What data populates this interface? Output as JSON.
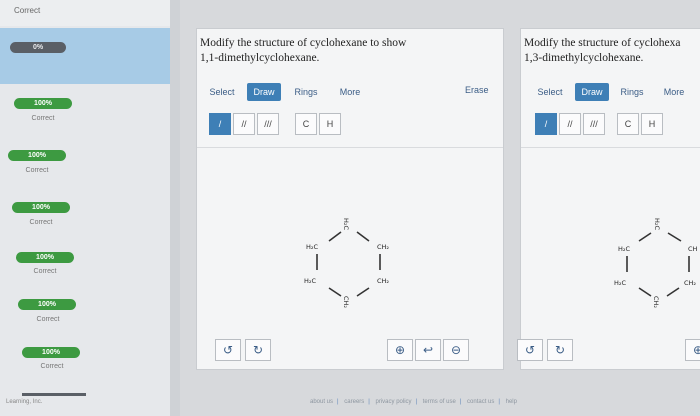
{
  "sidebar": {
    "top_label": "Correct",
    "overall_progress": "0%",
    "footer": "Learning, Inc.",
    "items": [
      {
        "percent": "100%",
        "status": "Correct"
      },
      {
        "percent": "100%",
        "status": "Correct"
      },
      {
        "percent": "100%",
        "status": "Correct"
      },
      {
        "percent": "100%",
        "status": "Correct"
      },
      {
        "percent": "100%",
        "status": "Correct"
      },
      {
        "percent": "100%",
        "status": "Correct"
      }
    ]
  },
  "questions": [
    {
      "text_line1": "Modify the structure of cyclohexane to show",
      "text_line2": "1,1-dimethylcyclohexane.",
      "tabs": {
        "select": "Select",
        "draw": "Draw",
        "rings": "Rings",
        "more": "More",
        "erase": "Erase"
      },
      "tools": {
        "single": "/",
        "double": "//",
        "triple": "///",
        "carbon": "C",
        "hydrogen": "H"
      },
      "molecule": {
        "top": "H₂C",
        "top_right": "CH₂",
        "bottom_right": "CH₂",
        "bottom": "CH₂",
        "bottom_left": "H₂C",
        "top_left": "H₂C"
      },
      "buttons": {
        "undo": "↺",
        "redo": "↻",
        "zoom_in": "⊕",
        "reset": "↩",
        "zoom_out": "⊖"
      }
    },
    {
      "text_line1": "Modify the structure of cyclohexa",
      "text_line2": "1,3-dimethylcyclohexane.",
      "tabs": {
        "select": "Select",
        "draw": "Draw",
        "rings": "Rings",
        "more": "More"
      },
      "tools": {
        "single": "/",
        "double": "//",
        "triple": "///",
        "carbon": "C",
        "hydrogen": "H"
      },
      "molecule": {
        "top": "H₂C",
        "top_right": "CH",
        "bottom_right": "CH₂",
        "bottom": "CH₂",
        "bottom_left": "H₂C",
        "top_left": "H₂C"
      },
      "buttons": {
        "undo": "↺",
        "redo": "↻",
        "zoom_in": "⊕"
      }
    }
  ],
  "footer_links": [
    "about us",
    "careers",
    "privacy policy",
    "terms of use",
    "contact us",
    "help"
  ],
  "colors": {
    "sidebar_bg": "#e6e8eb",
    "progress_band": "#a7cbe6",
    "correct_green": "#3d9a41",
    "accent_blue": "#3e7fb6"
  }
}
